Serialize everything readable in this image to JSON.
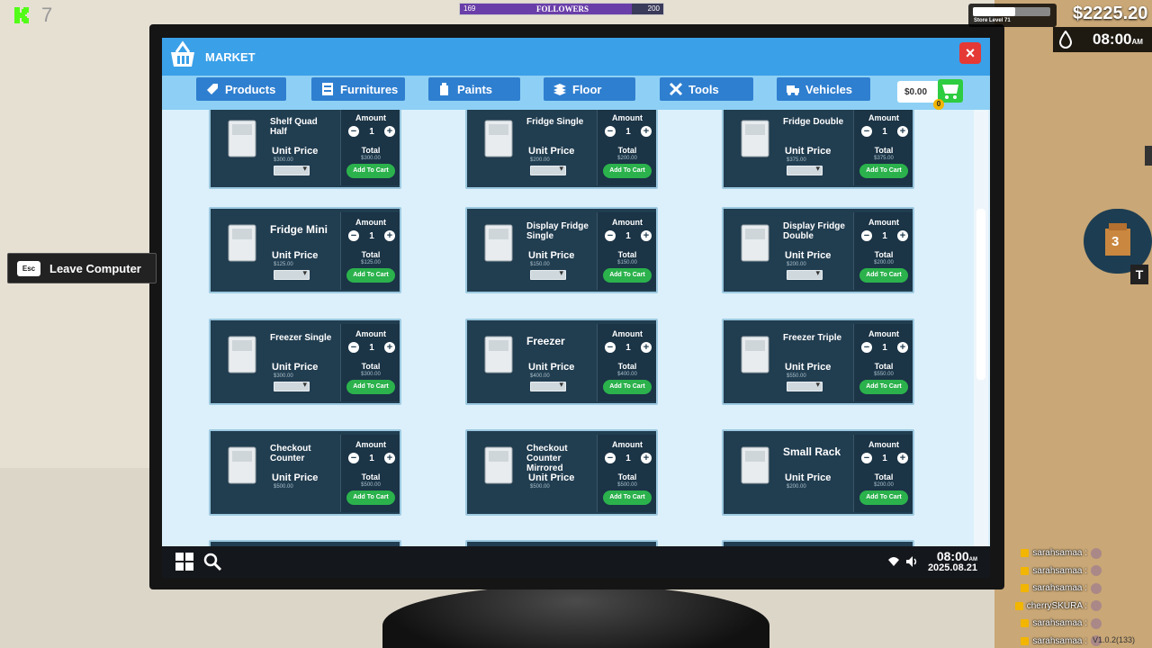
{
  "hud": {
    "level_count": "7",
    "followers_current": "169",
    "followers_label": "FOLLOWERS",
    "followers_goal": "200",
    "followers_fraction": 0.845,
    "money": "$2225.20",
    "store_level": "Store Level 71",
    "store_progress": 0.55,
    "clock": "08:00",
    "clock_suffix": "AM",
    "leave_key": "Esc",
    "leave_label": "Leave Computer",
    "bag_count": "3",
    "t_key": "T",
    "version": "V1.0.2(133)"
  },
  "market": {
    "title": "MARKET",
    "close": "×",
    "tabs": [
      "Products",
      "Furnitures",
      "Paints",
      "Floor",
      "Tools",
      "Vehicles"
    ],
    "cart_total": "$0.00",
    "cart_count": "0"
  },
  "labels": {
    "unit_price": "Unit Price",
    "amount": "Amount",
    "total": "Total",
    "add_to_cart": "Add To Cart",
    "minus": "−",
    "plus": "+",
    "qty": "1"
  },
  "products": [
    {
      "name": "Shelf Quad Half",
      "price": "$300.00",
      "total": "$300.00"
    },
    {
      "name": "Fridge Single",
      "price": "$200.00",
      "total": "$200.00"
    },
    {
      "name": "Fridge Double",
      "price": "$375.00",
      "total": "$375.00"
    },
    {
      "name": "Fridge Mini",
      "price": "$125.00",
      "total": "$125.00"
    },
    {
      "name": "Display Fridge Single",
      "price": "$150.00",
      "total": "$150.00"
    },
    {
      "name": "Display Fridge Double",
      "price": "$200.00",
      "total": "$200.00"
    },
    {
      "name": "Freezer Single",
      "price": "$300.00",
      "total": "$300.00"
    },
    {
      "name": "Freezer",
      "price": "$400.00",
      "total": "$400.00"
    },
    {
      "name": "Freezer Triple",
      "price": "$550.00",
      "total": "$550.00"
    },
    {
      "name": "Checkout Counter",
      "price": "$500.00",
      "total": "$500.00"
    },
    {
      "name": "Checkout Counter Mirrored",
      "price": "$500.00",
      "total": "$500.00"
    },
    {
      "name": "Small Rack",
      "price": "$200.00",
      "total": "$200.00"
    }
  ],
  "taskbar": {
    "time": "08:00",
    "time_suffix": "AM",
    "date": "2025.08.21"
  },
  "chat": [
    "sarahsamaa :",
    "sarahsamaa :",
    "sarahsamaa :",
    "cherrySKURA :",
    "sarahsamaa :",
    "sarahsamaa :"
  ]
}
